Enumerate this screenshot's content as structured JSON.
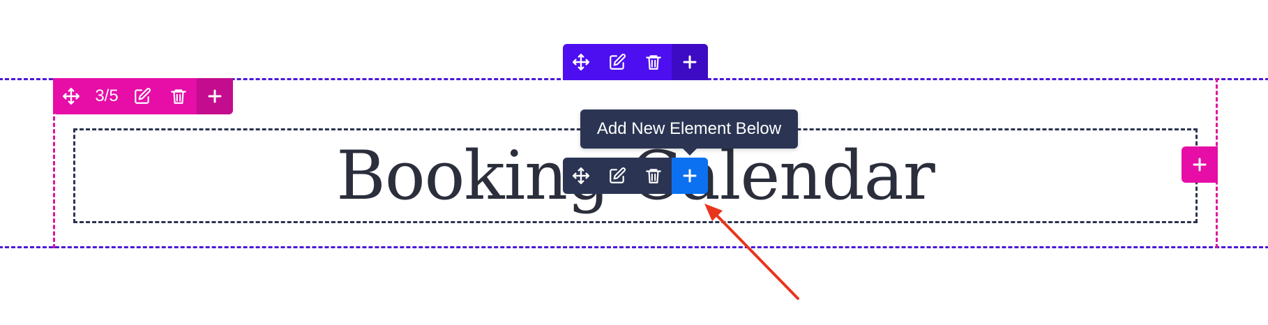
{
  "heading": {
    "text": "Booking Calendar"
  },
  "row_toolbar": {
    "counter": "3/5"
  },
  "tooltip": {
    "text": "Add New Element Below"
  },
  "icons": {
    "move": "move-icon",
    "edit": "edit-icon",
    "delete": "trash-icon",
    "add": "plus-icon"
  },
  "colors": {
    "section_accent": "#4e0ff0",
    "row_accent": "#e60ea7",
    "module_toolbar": "#2b3553",
    "module_add": "#0c71f0",
    "annotation_arrow": "#e8351c"
  }
}
